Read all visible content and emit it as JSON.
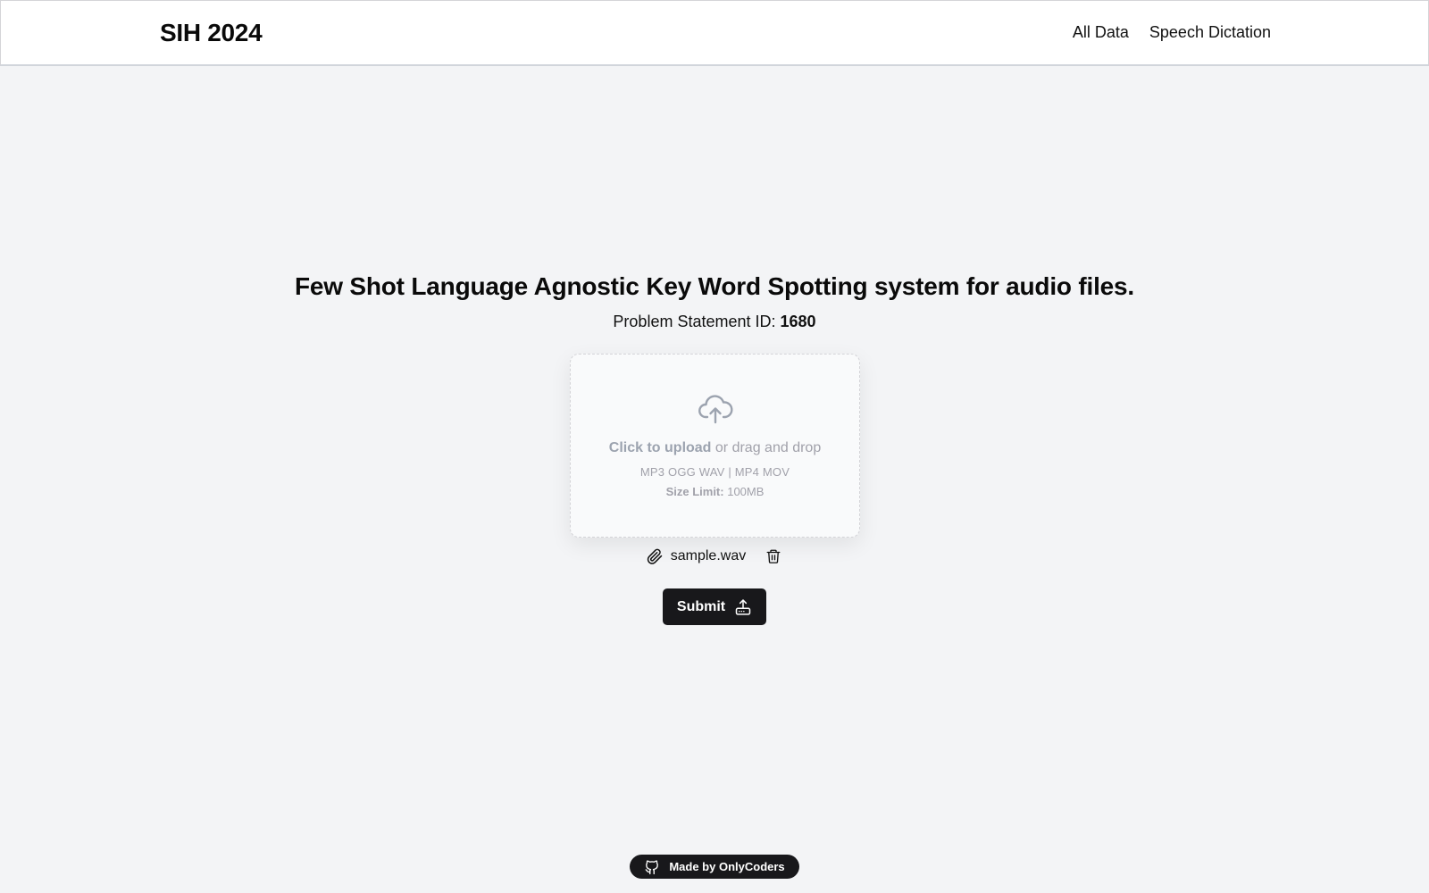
{
  "navbar": {
    "brand": "SIH 2024",
    "links": [
      "All Data",
      "Speech Dictation"
    ]
  },
  "main": {
    "headline": "Few Shot Language Agnostic Key Word Spotting system for audio files.",
    "problem_label": "Problem Statement ID:",
    "problem_id": "1680"
  },
  "upload": {
    "click_text": "Click to upload",
    "drag_text": "or drag and drop",
    "formats": "MP3 OGG WAV | MP4 MOV",
    "size_label": "Size Limit:",
    "size_value": "100MB",
    "icon": "cloud-upload-icon"
  },
  "file": {
    "name": "sample.wav",
    "attach_icon": "paperclip-icon",
    "delete_icon": "trash-icon"
  },
  "submit": {
    "label": "Submit",
    "icon": "upload-tray-icon"
  },
  "footer": {
    "badge_label": "Made by OnlyCoders",
    "icon": "github-icon"
  },
  "colors": {
    "background": "#f3f4f6",
    "primary_dark": "#18181b",
    "muted_text": "#a1a1aa"
  }
}
